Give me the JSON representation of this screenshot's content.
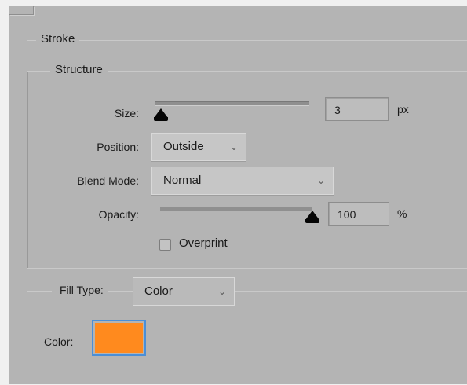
{
  "stroke": {
    "title": "Stroke",
    "structure": {
      "title": "Structure",
      "size": {
        "label": "Size:",
        "value": "3",
        "unit": "px",
        "slider_fraction": 0.0
      },
      "position": {
        "label": "Position:",
        "selected": "Outside"
      },
      "blend_mode": {
        "label": "Blend Mode:",
        "selected": "Normal"
      },
      "opacity": {
        "label": "Opacity:",
        "value": "100",
        "unit": "%",
        "slider_fraction": 1.0
      },
      "overprint": {
        "label": "Overprint",
        "checked": false
      }
    },
    "fill": {
      "type_label": "Fill Type:",
      "type_selected": "Color",
      "color_label": "Color:",
      "color_hex": "#ff8a1e"
    }
  },
  "icons": {
    "dropdown": "chevron-down-icon",
    "slider": "triangle-slider-thumb"
  }
}
